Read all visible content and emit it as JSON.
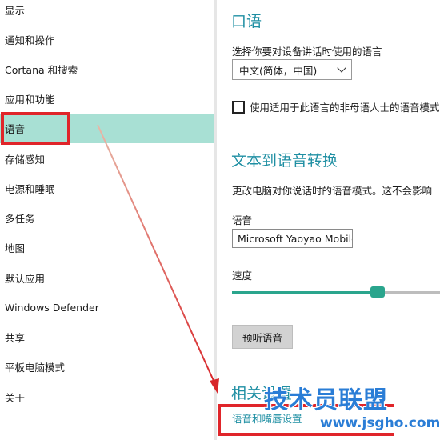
{
  "sidebar": {
    "items": [
      {
        "label": "显示"
      },
      {
        "label": "通知和操作"
      },
      {
        "label": "Cortana 和搜索"
      },
      {
        "label": "应用和功能"
      },
      {
        "label": "语音",
        "selected": true
      },
      {
        "label": "存储感知"
      },
      {
        "label": "电源和睡眠"
      },
      {
        "label": "多任务"
      },
      {
        "label": "地图"
      },
      {
        "label": "默认应用"
      },
      {
        "label": "Windows Defender"
      },
      {
        "label": "共享"
      },
      {
        "label": "平板电脑模式"
      },
      {
        "label": "关于"
      }
    ],
    "selected_color": "#a8e0d4"
  },
  "speech": {
    "title": "口语",
    "language_prompt": "选择你要对设备讲话时使用的语言",
    "language_value": "中文(简体，中国)",
    "nonnative_label": "使用适用于此语言的非母语人士的语音模式",
    "nonnative_checked": false
  },
  "tts": {
    "title": "文本到语音转换",
    "description": "更改电脑对你说话时的语音模式。这不会影响",
    "voice_label": "语音",
    "voice_value": "Microsoft Yaoyao Mobile",
    "speed_label": "速度",
    "speed_value": 0.7,
    "preview_button": "预听语音"
  },
  "related": {
    "title": "相关设置",
    "link": "语音和嘴唇设置"
  },
  "watermark": {
    "text": "技术员联盟",
    "url": "www.jsgho.com"
  },
  "colors": {
    "accent": "#1f8fa3",
    "slider": "#2aa58d",
    "highlight": "#e0252a"
  }
}
